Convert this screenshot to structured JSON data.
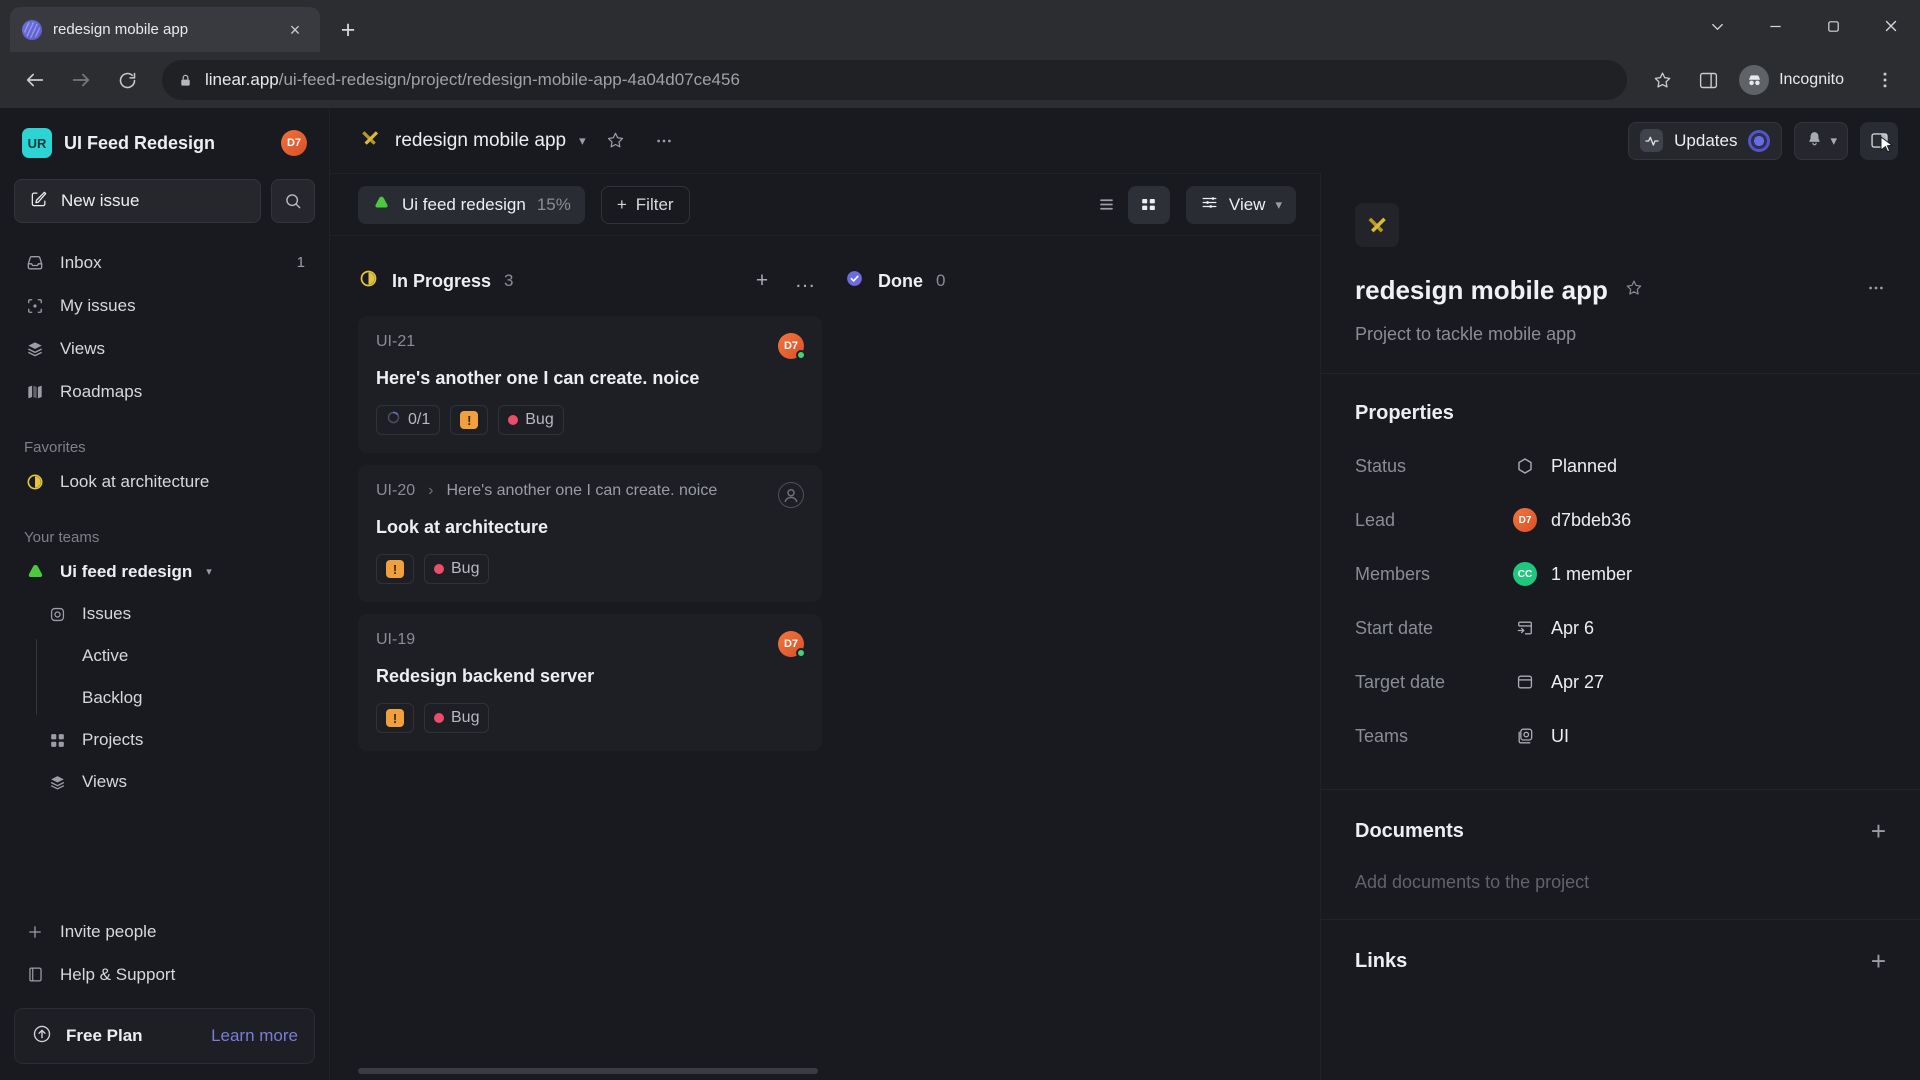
{
  "browser": {
    "tab": {
      "title": "redesign mobile app",
      "favicon": "linear-logo-icon",
      "close": "×"
    },
    "new_tab_label": "+",
    "window_controls": {
      "minimize": "–",
      "maximize": "❐",
      "close": "✕",
      "chevron": "⌄"
    },
    "nav": {
      "back": "←",
      "forward": "→",
      "reload": "⟳"
    },
    "url": {
      "domain": "linear.app",
      "path": "/ui-feed-redesign/project/redesign-mobile-app-4a04d07ce456"
    },
    "profile_label": "Incognito"
  },
  "sidebar": {
    "workspace": {
      "initials": "UR",
      "name": "UI Feed Redesign",
      "avatar_initials": "D7"
    },
    "new_issue_label": "New issue",
    "search_icon": "search-icon",
    "nav": [
      {
        "label": "Inbox",
        "icon": "inbox-icon",
        "count": "1"
      },
      {
        "label": "My issues",
        "icon": "my-issues-icon",
        "count": ""
      },
      {
        "label": "Views",
        "icon": "views-icon",
        "count": ""
      },
      {
        "label": "Roadmaps",
        "icon": "roadmaps-icon",
        "count": ""
      }
    ],
    "favorites_title": "Favorites",
    "favorites": [
      {
        "label": "Look at architecture",
        "icon": "in-progress-icon"
      }
    ],
    "teams_title": "Your teams",
    "team": {
      "name": "Ui feed redesign",
      "icon": "green-cloud-icon"
    },
    "team_items": [
      {
        "label": "Issues",
        "icon": "issues-icon",
        "sub": false
      },
      {
        "label": "Active",
        "icon": "",
        "sub": true
      },
      {
        "label": "Backlog",
        "icon": "",
        "sub": true
      },
      {
        "label": "Projects",
        "icon": "projects-icon",
        "sub": false
      },
      {
        "label": "Views",
        "icon": "views-icon",
        "sub": false
      }
    ],
    "bottom": [
      {
        "label": "Invite people",
        "icon": "plus-icon"
      },
      {
        "label": "Help & Support",
        "icon": "book-icon"
      }
    ],
    "plan": {
      "name": "Free Plan",
      "link": "Learn more",
      "icon": "upgrade-icon"
    }
  },
  "header": {
    "project_icon": "project-ribbon-icon",
    "project_name": "redesign mobile app",
    "chevron": "⌄",
    "star_icon": "star-icon",
    "more_icon": "…",
    "updates_label": "Updates",
    "bell_icon": "bell-icon",
    "panel_toggle_icon": "right-panel-toggle-icon"
  },
  "filterbar": {
    "chip": {
      "label": "Ui feed redesign",
      "percent": "15%",
      "icon": "green-cloud-icon"
    },
    "filter_label": "Filter",
    "filter_plus": "+",
    "list_view_icon": "list-view-icon",
    "board_view_icon": "board-view-icon",
    "view_label": "View",
    "view_chevron": "⌄"
  },
  "board": {
    "columns": [
      {
        "name": "In Progress",
        "count": "3",
        "icon": "in-progress-icon",
        "add": "+",
        "more": "…",
        "cards": [
          {
            "id": "UI-21",
            "parent": "",
            "title": "Here's another one I can create. noice",
            "avatar": "D7",
            "avatar_type": "user",
            "progress": "0/1",
            "priority": "!",
            "label": "Bug"
          },
          {
            "id": "UI-20",
            "parent": "Here's another one I can create. noice",
            "title": "Look at architecture",
            "avatar": "",
            "avatar_type": "empty",
            "progress": "",
            "priority": "!",
            "label": "Bug"
          },
          {
            "id": "UI-19",
            "parent": "",
            "title": "Redesign backend server",
            "avatar": "D7",
            "avatar_type": "user",
            "progress": "",
            "priority": "!",
            "label": "Bug"
          }
        ]
      },
      {
        "name": "Done",
        "count": "0",
        "icon": "done-icon",
        "add": "+",
        "more": "…",
        "cards": []
      }
    ]
  },
  "rpanel": {
    "project_icon": "project-ribbon-icon",
    "title": "redesign mobile app",
    "star_icon": "star-icon",
    "more_icon": "…",
    "description": "Project to tackle mobile app",
    "properties_title": "Properties",
    "properties": [
      {
        "label": "Status",
        "value": "Planned",
        "icon": "hexagon-icon",
        "avatar": "",
        "avatar_color": ""
      },
      {
        "label": "Lead",
        "value": "d7bdeb36",
        "icon": "",
        "avatar": "D7",
        "avatar_color": "orange"
      },
      {
        "label": "Members",
        "value": "1 member",
        "icon": "",
        "avatar": "CC",
        "avatar_color": "green"
      },
      {
        "label": "Start date",
        "value": "Apr 6",
        "icon": "start-date-icon",
        "avatar": "",
        "avatar_color": ""
      },
      {
        "label": "Target date",
        "value": "Apr 27",
        "icon": "target-date-icon",
        "avatar": "",
        "avatar_color": ""
      },
      {
        "label": "Teams",
        "value": "UI",
        "icon": "teams-icon",
        "avatar": "",
        "avatar_color": ""
      }
    ],
    "documents_title": "Documents",
    "documents_add": "+",
    "documents_empty": "Add documents to the project",
    "links_title": "Links",
    "links_add": "+"
  }
}
